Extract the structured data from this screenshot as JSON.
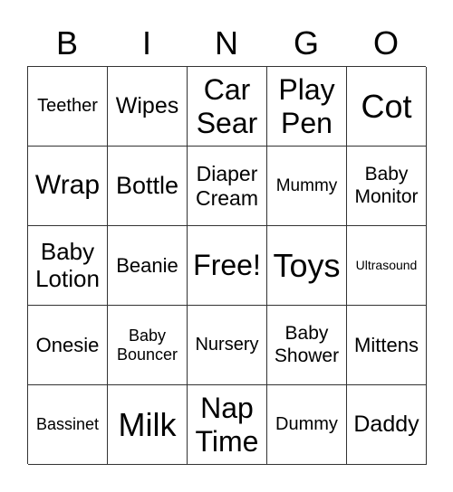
{
  "header": [
    "B",
    "I",
    "N",
    "G",
    "O"
  ],
  "cells": [
    [
      "Teether",
      "Wipes",
      "Car\nSear",
      "Play\nPen",
      "Cot"
    ],
    [
      "Wrap",
      "Bottle",
      "Diaper\nCream",
      "Mummy",
      "Baby\nMonitor"
    ],
    [
      "Baby\nLotion",
      "Beanie",
      "Free!",
      "Toys",
      "Ultrasound"
    ],
    [
      "Onesie",
      "Baby\nBouncer",
      "Nursery",
      "Baby\nShower",
      "Mittens"
    ],
    [
      "Bassinet",
      "Milk",
      "Nap\nTime",
      "Dummy",
      "Daddy"
    ]
  ]
}
